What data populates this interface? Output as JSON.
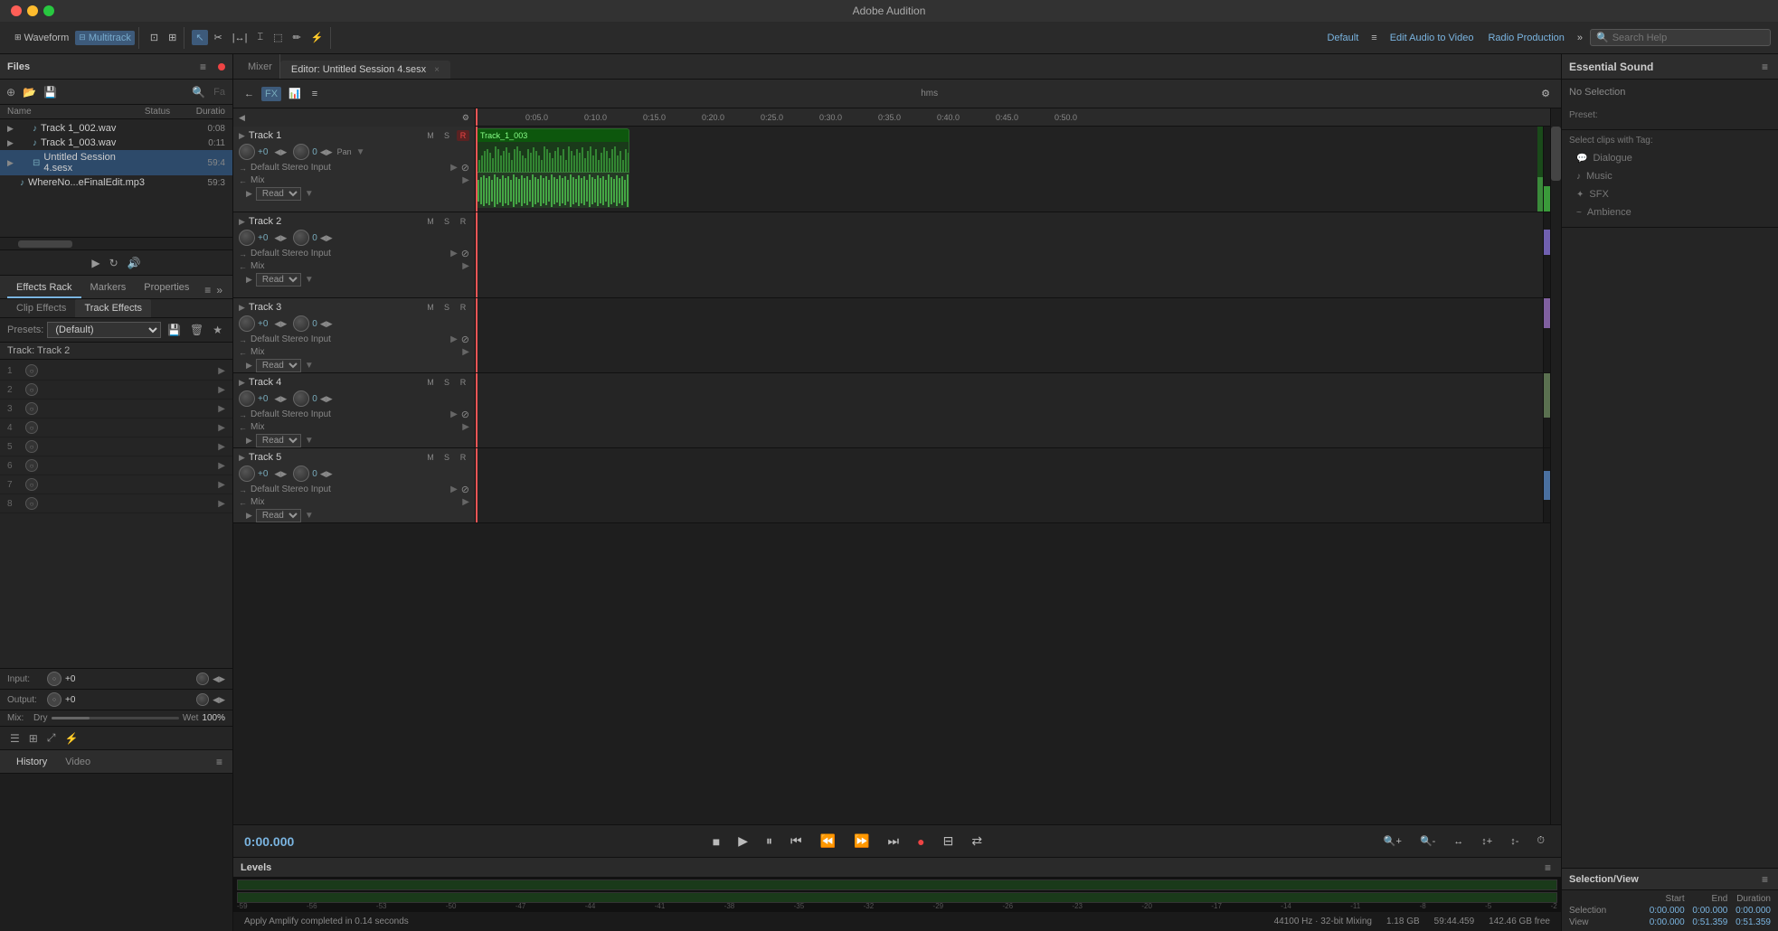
{
  "app": {
    "title": "Adobe Audition",
    "waveform_label": "Waveform",
    "multitrack_label": "Multitrack"
  },
  "toolbar": {
    "workspace_default": "Default",
    "workspace_edit_audio": "Edit Audio to Video",
    "workspace_radio": "Radio Production",
    "search_placeholder": "Search Help",
    "search_label": "Search Help"
  },
  "files_panel": {
    "title": "Files",
    "columns": {
      "name": "Name",
      "status": "Status",
      "duration": "Duratio"
    },
    "files": [
      {
        "name": "Track 1_002.wav",
        "indent": 1,
        "duration": "0:08",
        "type": "audio"
      },
      {
        "name": "Track 1_003.wav",
        "indent": 1,
        "duration": "0:11",
        "type": "audio"
      },
      {
        "name": "Untitled Session 4.sesx",
        "indent": 1,
        "duration": "59:4",
        "type": "session",
        "selected": true
      },
      {
        "name": "WhereNo...eFinalEdit.mp3",
        "indent": 1,
        "duration": "59:3",
        "type": "audio"
      }
    ]
  },
  "effects_panel": {
    "title": "Effects Rack",
    "tabs": [
      "Effects Rack",
      "Markers",
      "Properties"
    ],
    "sub_tabs": [
      "Clip Effects",
      "Track Effects"
    ],
    "active_sub_tab": "Track Effects",
    "presets_label": "Presets:",
    "presets_default": "(Default)",
    "track_label": "Track: Track 2",
    "slots": [
      {
        "num": 1
      },
      {
        "num": 2
      },
      {
        "num": 3
      },
      {
        "num": 4
      },
      {
        "num": 5
      },
      {
        "num": 6
      },
      {
        "num": 7
      },
      {
        "num": 8
      }
    ],
    "input_label": "Input:",
    "output_label": "Output:",
    "input_val": "+0",
    "output_val": "+0",
    "mix_label": "Mix:",
    "mix_dry": "Dry",
    "mix_wet": "Wet",
    "mix_pct": "100%",
    "bottom_icons": [
      "list-icon",
      "grid-icon",
      "expand-icon",
      "lightning-icon"
    ]
  },
  "history_panel": {
    "tabs": [
      "History",
      "Video"
    ],
    "active_tab": "History",
    "video_tab": "Video"
  },
  "editor": {
    "mixer_label": "Mixer",
    "tab_label": "Editor: Untitled Session 4.sesx",
    "tab_modified": true,
    "time_display": "0:00.000",
    "tracks": [
      {
        "id": 1,
        "name": "Track 1",
        "m": "M",
        "s": "S",
        "r": "R",
        "vol": "+0",
        "pan_val": "0",
        "input": "Default Stereo Input",
        "read": "Read",
        "clip_name": "Track_1_003",
        "clip_color": "#3a8a3a",
        "has_clip": true
      },
      {
        "id": 2,
        "name": "Track 2",
        "m": "M",
        "s": "S",
        "r": "R",
        "vol": "+0",
        "pan_val": "0",
        "input": "Default Stereo Input",
        "read": "Read"
      },
      {
        "id": 3,
        "name": "Track 3",
        "m": "M",
        "s": "S",
        "r": "R",
        "vol": "+0",
        "pan_val": "0",
        "input": "Default Stereo Input",
        "read": "Read"
      },
      {
        "id": 4,
        "name": "Track 4",
        "m": "M",
        "s": "S",
        "r": "R",
        "vol": "+0",
        "pan_val": "0",
        "input": "Default Stereo Input",
        "read": "Read"
      },
      {
        "id": 5,
        "name": "Track 5",
        "m": "M",
        "s": "S",
        "r": "R",
        "vol": "+0",
        "pan_val": "0",
        "input": "Default Stereo Input",
        "read": "Read"
      }
    ],
    "ruler_marks": [
      "0:05.0",
      "0:10.0",
      "0:15.0",
      "0:20.0",
      "0:25.0",
      "0:30.0",
      "0:35.0",
      "0:40.0",
      "0:45.0",
      "0:50.0"
    ]
  },
  "transport": {
    "time": "0:00.000",
    "stop": "■",
    "play": "▶",
    "pause": "⏸",
    "go_start": "⏮",
    "go_prev": "⏪",
    "go_next": "⏩",
    "go_end": "⏭",
    "record": "●",
    "loop": "↻"
  },
  "levels_panel": {
    "title": "Levels",
    "scale_marks": [
      "-59",
      "-56",
      "-53",
      "-50",
      "-47",
      "-44",
      "-41",
      "-38",
      "-35",
      "-32",
      "-29",
      "-26",
      "-23",
      "-20",
      "-17",
      "-14",
      "-11",
      "-8",
      "-5",
      "-2"
    ]
  },
  "status_bar": {
    "apply_text": "Apply Amplify completed in 0.14 seconds",
    "sample_rate": "44100 Hz · 32-bit Mixing",
    "disk": "1.18 GB",
    "time_total": "59:44.459",
    "free": "142.46 GB free"
  },
  "essential_sound": {
    "title": "Essential Sound",
    "no_selection": "No Selection",
    "preset_label": "Preset:",
    "select_clips_label": "Select clips with Tag:",
    "tags": [
      "Dialogue",
      "Music",
      "SFX",
      "Ambience"
    ]
  },
  "selection_view": {
    "title": "Selection/View",
    "col_start": "Start",
    "col_end": "End",
    "col_duration": "Duration",
    "row_selection": "Selection",
    "row_view": "View",
    "selection_start": "0:00.000",
    "selection_end": "0:00.000",
    "selection_dur": "0:00.000",
    "view_start": "0:00.000",
    "view_end": "0:51.359",
    "view_dur": "0:51.359"
  }
}
